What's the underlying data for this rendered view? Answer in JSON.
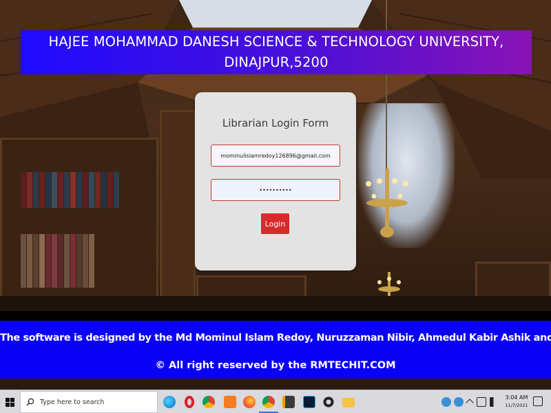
{
  "header": {
    "title": "HAJEE MOHAMMAD DANESH SCIENCE & TECHNOLOGY UNIVERSITY, DINAJPUR,5200"
  },
  "login_form": {
    "title": "Librarian Login Form",
    "email_value": "mominulislamredoy126896@gmail.com",
    "password_value": "••••••••••",
    "login_label": "Login"
  },
  "footer": {
    "credits": "The software is designed by the Md Mominul Islam Redoy, Nuruzzaman Nibir, Ahmedul Kabir Ashik and special",
    "copyright": "© All right reserved by the RMTECHIT.COM"
  },
  "taskbar": {
    "search_placeholder": "Type here to search",
    "time": "3:04 AM",
    "date": "11/7/2021",
    "apps": [
      "edge-icon",
      "opera-icon",
      "chrome-icon",
      "xampp-icon",
      "firefox-icon",
      "chrome-icon",
      "sublime-icon",
      "photoshop-icon",
      "settings-icon",
      "file-explorer-icon"
    ]
  },
  "colors": {
    "banner_start": "#1f0bff",
    "banner_end": "#8a12b6",
    "footer_blue": "#0a00f5",
    "login_button": "#d62b2b",
    "field_border": "#c0392b"
  }
}
